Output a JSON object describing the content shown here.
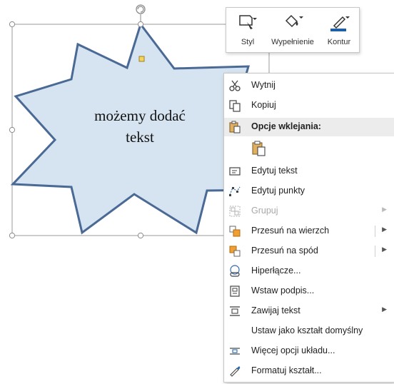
{
  "shape": {
    "text_line1": "możemy dodać",
    "text_line2": "tekst"
  },
  "colors": {
    "shape_fill": "#d6e3f0",
    "shape_stroke": "#4a6a95",
    "handle_yellow": "#f5d35c",
    "menu_header_bg": "#ececec",
    "disabled_text": "#a8a8a8"
  },
  "mini_toolbar": {
    "style_label": "Styl",
    "fill_label": "Wypełnienie",
    "outline_label": "Kontur"
  },
  "context_menu": {
    "items": [
      {
        "label": "Wytnij",
        "icon": "scissors-icon"
      },
      {
        "label": "Kopiuj",
        "icon": "copy-icon"
      },
      {
        "label": "Opcje wklejania:",
        "icon": "paste-icon",
        "header": true
      },
      {
        "label": "Edytuj tekst",
        "icon": "edit-text-icon"
      },
      {
        "label": "Edytuj punkty",
        "icon": "edit-points-icon"
      },
      {
        "label": "Grupuj",
        "icon": "group-icon",
        "disabled": true
      },
      {
        "label": "Przesuń na wierzch",
        "icon": "bring-to-front-icon"
      },
      {
        "label": "Przesuń na spód",
        "icon": "send-to-back-icon"
      },
      {
        "label": "Hiperłącze...",
        "icon": "hyperlink-icon"
      },
      {
        "label": "Wstaw podpis...",
        "icon": "insert-caption-icon"
      },
      {
        "label": "Zawijaj tekst",
        "icon": "wrap-text-icon"
      },
      {
        "label": "Ustaw jako kształt domyślny",
        "icon": ""
      },
      {
        "label": "Więcej opcji układu...",
        "icon": "layout-options-icon"
      },
      {
        "label": "Formatuj kształt...",
        "icon": "format-shape-icon"
      }
    ]
  }
}
